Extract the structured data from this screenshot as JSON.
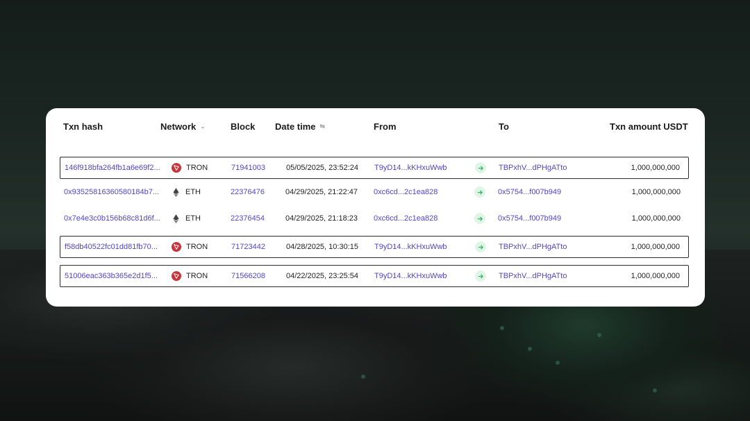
{
  "table": {
    "headers": {
      "hash": "Txn hash",
      "network": "Network",
      "block": "Block",
      "datetime": "Date time",
      "from": "From",
      "to": "To",
      "amount": "Txn amount USDT"
    },
    "rows": [
      {
        "hash": "146f918bfa264fb1a6e69f2...",
        "network": "TRON",
        "network_icon": "tron-icon",
        "block": "71941003",
        "datetime": "05/05/2025, 23:52:24",
        "from": "T9yD14...kKHxuWwb",
        "to": "TBPxhV...dPHgATto",
        "amount": "1,000,000,000",
        "highlighted": true
      },
      {
        "hash": "0x93525816360580184b7...",
        "network": "ETH",
        "network_icon": "ethereum-icon",
        "block": "22376476",
        "datetime": "04/29/2025, 21:22:47",
        "from": "0xc6cd...2c1ea828",
        "to": "0x5754...f007b949",
        "amount": "1,000,000,000",
        "highlighted": false
      },
      {
        "hash": "0x7e4e3c0b156b68c81d6f...",
        "network": "ETH",
        "network_icon": "ethereum-icon",
        "block": "22376454",
        "datetime": "04/29/2025, 21:18:23",
        "from": "0xc6cd...2c1ea828",
        "to": "0x5754...f007b949",
        "amount": "1,000,000,000",
        "highlighted": false
      },
      {
        "hash": "f58db40522fc01dd81fb70...",
        "network": "TRON",
        "network_icon": "tron-icon",
        "block": "71723442",
        "datetime": "04/28/2025, 10:30:15",
        "from": "T9yD14...kKHxuWwb",
        "to": "TBPxhV...dPHgATto",
        "amount": "1,000,000,000",
        "highlighted": true
      },
      {
        "hash": "51006eac363b365e2d1f5...",
        "network": "TRON",
        "network_icon": "tron-icon",
        "block": "71566208",
        "datetime": "04/22/2025, 23:25:54",
        "from": "T9yD14...kKHxuWwb",
        "to": "TBPxhV...dPHgATto",
        "amount": "1,000,000,000",
        "highlighted": true
      }
    ]
  },
  "colors": {
    "link": "#5046c8",
    "tron": "#c8343b",
    "arrow_bg": "#dff5e6",
    "arrow": "#3fb26a"
  }
}
